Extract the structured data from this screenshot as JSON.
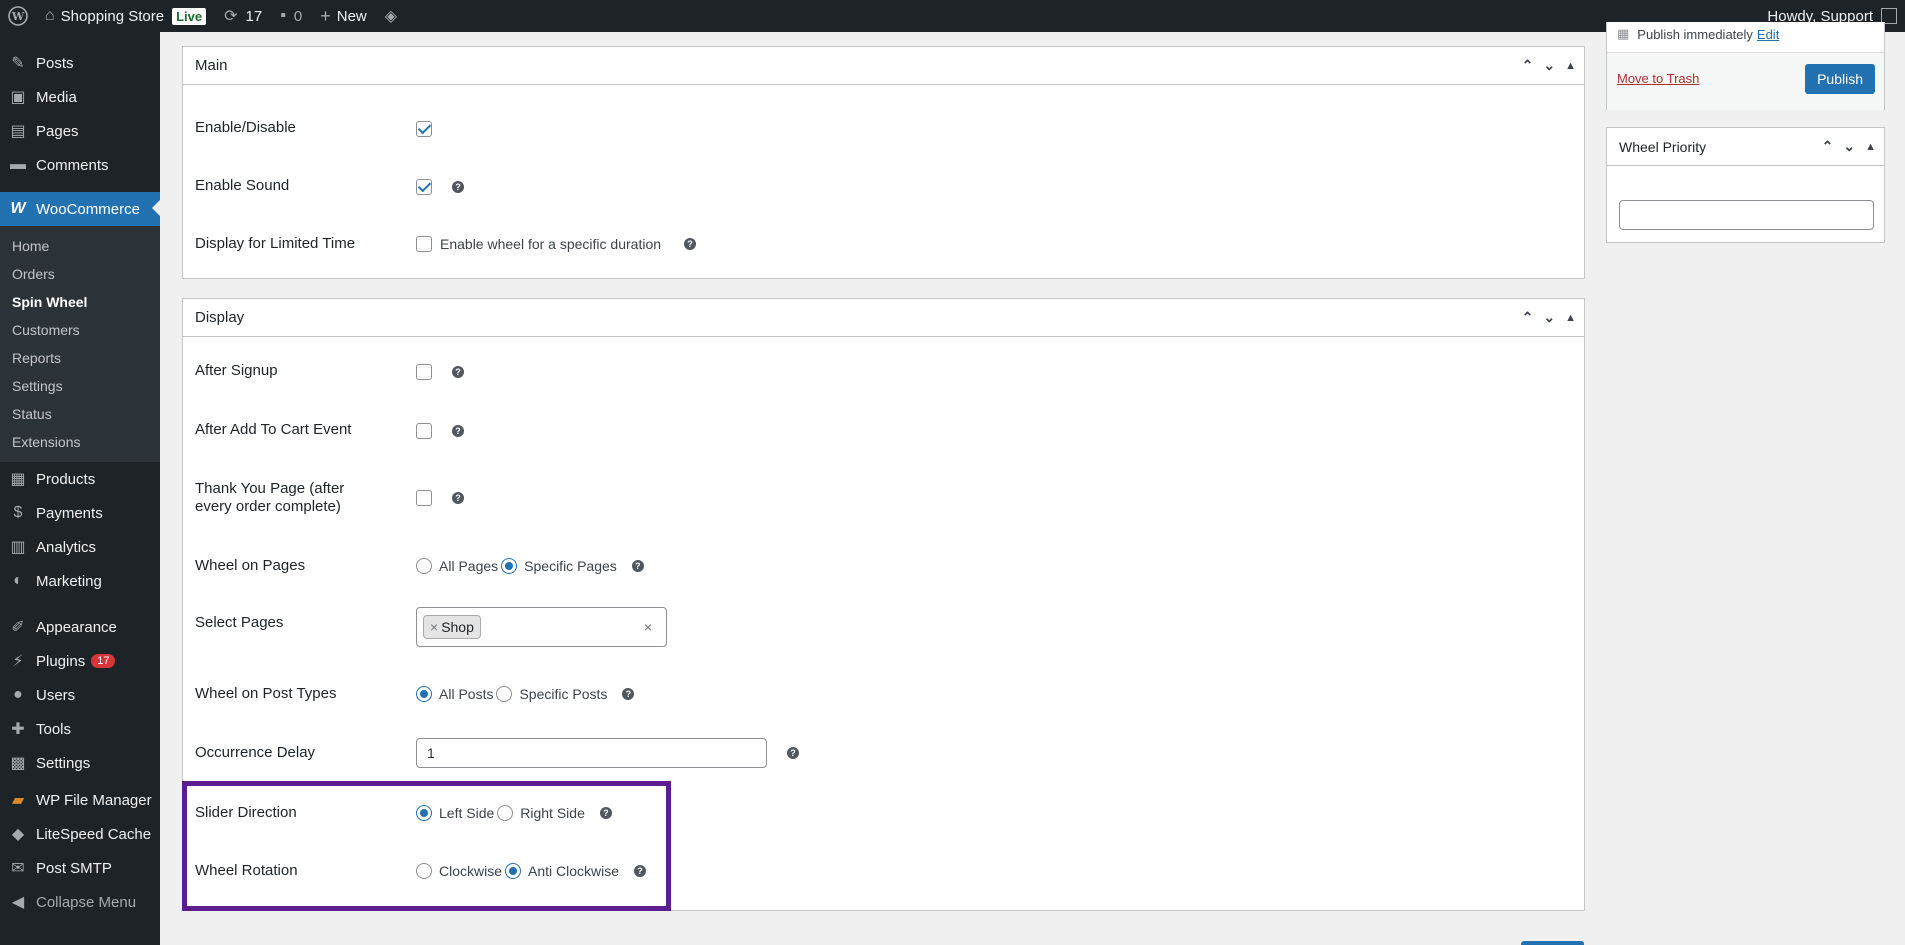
{
  "adminbar": {
    "site_name": "Shopping Store",
    "live_label": "Live",
    "updates_count": "17",
    "comments_count": "0",
    "new_label": "New",
    "howdy": "Howdy, Support"
  },
  "sidebar": {
    "items_top": [
      {
        "label": "Posts",
        "icon": "pin-icon"
      },
      {
        "label": "Media",
        "icon": "media-icon"
      },
      {
        "label": "Pages",
        "icon": "pages-icon"
      },
      {
        "label": "Comments",
        "icon": "comment-icon"
      }
    ],
    "woocommerce_label": "WooCommerce",
    "woo_sub": [
      "Home",
      "Orders",
      "Spin Wheel",
      "Customers",
      "Reports",
      "Settings",
      "Status",
      "Extensions"
    ],
    "items_mid": [
      {
        "label": "Products"
      },
      {
        "label": "Payments"
      },
      {
        "label": "Analytics"
      },
      {
        "label": "Marketing"
      }
    ],
    "items_bottom": [
      {
        "label": "Appearance"
      },
      {
        "label": "Plugins",
        "badge": "17"
      },
      {
        "label": "Users"
      },
      {
        "label": "Tools"
      },
      {
        "label": "Settings"
      }
    ],
    "items_plugins": [
      {
        "label": "WP File Manager"
      },
      {
        "label": "LiteSpeed Cache"
      },
      {
        "label": "Post SMTP"
      }
    ],
    "collapse_label": "Collapse Menu"
  },
  "main_panel": {
    "title": "Main",
    "enable_disable_label": "Enable/Disable",
    "enable_sound_label": "Enable Sound",
    "limited_time_label": "Display for Limited Time",
    "limited_time_option": "Enable wheel for a specific duration"
  },
  "display_panel": {
    "title": "Display",
    "after_signup_label": "After Signup",
    "after_cart_label": "After Add To Cart Event",
    "thank_you_label": "Thank You Page (after every order complete)",
    "wheel_pages_label": "Wheel on Pages",
    "wheel_pages_opt1": "All Pages",
    "wheel_pages_opt2": "Specific Pages",
    "select_pages_label": "Select Pages",
    "select_pages_tag": "Shop",
    "post_types_label": "Wheel on Post Types",
    "post_types_opt1": "All Posts",
    "post_types_opt2": "Specific Posts",
    "occurrence_label": "Occurrence Delay",
    "occurrence_value": "1",
    "slider_label": "Slider Direction",
    "slider_opt1": "Left Side",
    "slider_opt2": "Right Side",
    "rotation_label": "Wheel Rotation",
    "rotation_opt1": "Clockwise",
    "rotation_opt2": "Anti Clockwise"
  },
  "publish_box": {
    "publish_text": "Publish immediately",
    "edit_link": "Edit",
    "trash_link": "Move to Trash",
    "publish_button": "Publish"
  },
  "priority_box": {
    "title": "Wheel Priority"
  }
}
